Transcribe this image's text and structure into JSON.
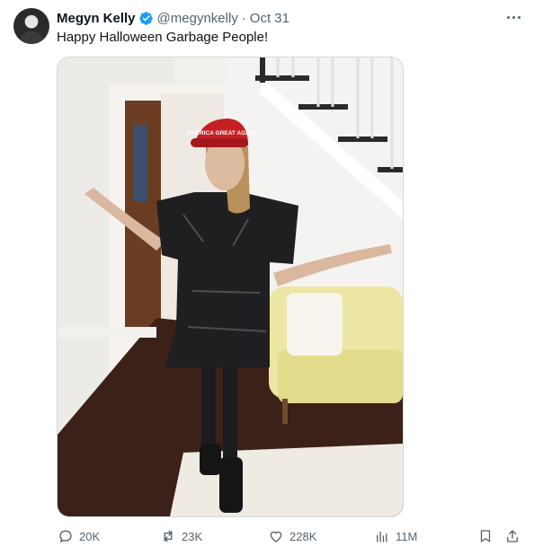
{
  "tweet": {
    "author_name": "Megyn Kelly",
    "handle": "@megynkelly",
    "separator": "·",
    "date": "Oct 31",
    "text": "Happy Halloween Garbage People!",
    "photo_hat_text": "AMERICA GREAT AGAIN"
  },
  "actions": {
    "replies": "20K",
    "reposts": "23K",
    "likes": "228K",
    "views": "11M"
  },
  "colors": {
    "verified": "#1d9bf0",
    "secondary_text": "#536471",
    "primary_text": "#0f1419"
  },
  "icons": {
    "more": "more-horizontal-icon",
    "verified": "verified-badge-icon",
    "reply": "reply-icon",
    "repost": "repost-icon",
    "like": "like-icon",
    "views": "views-icon",
    "bookmark": "bookmark-icon",
    "share": "share-icon"
  }
}
